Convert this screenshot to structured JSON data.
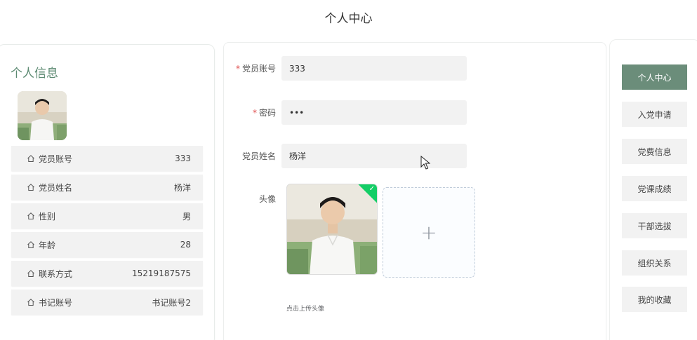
{
  "page": {
    "title": "个人中心"
  },
  "left": {
    "title": "个人信息",
    "rows": [
      {
        "label": "党员账号",
        "value": "333"
      },
      {
        "label": "党员姓名",
        "value": "杨洋"
      },
      {
        "label": "性别",
        "value": "男"
      },
      {
        "label": "年龄",
        "value": "28"
      },
      {
        "label": "联系方式",
        "value": "15219187575"
      },
      {
        "label": "书记账号",
        "value": "书记账号2"
      }
    ]
  },
  "form": {
    "account_label": "党员账号",
    "account_value": "333",
    "password_label": "密码",
    "password_value": "•••",
    "name_label": "党员姓名",
    "name_value": "杨洋",
    "avatar_label": "头像",
    "upload_tip": "点击上传头像"
  },
  "nav": {
    "items": [
      "个人中心",
      "入党申请",
      "党费信息",
      "党课成绩",
      "干部选拔",
      "组织关系",
      "我的收藏"
    ]
  },
  "colors": {
    "accent": "#6b8d7a",
    "title_green": "#5c8a72",
    "required": "#e05252",
    "success": "#13ce66"
  }
}
